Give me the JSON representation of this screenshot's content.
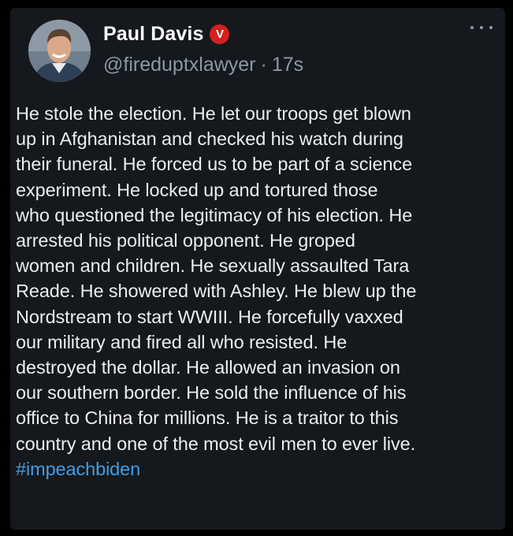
{
  "author": {
    "name": "Paul Davis",
    "badge": "V",
    "handle": "@fireduptxlawyer",
    "separator": "·",
    "timestamp": "17s"
  },
  "post": {
    "lines": [
      "He stole the election. He let our troops get blown",
      "up in Afghanistan and checked his watch during",
      "their funeral. He forced us to be part of a science",
      "experiment. He locked up and tortured those",
      "who questioned the legitimacy of his election. He",
      "arrested his political opponent. He groped",
      "women and children. He sexually assaulted Tara",
      "Reade. He showered with Ashley. He blew up the",
      "Nordstream to start WWIII. He forcefully vaxxed",
      "our military and fired all who resisted. He",
      "destroyed the dollar. He allowed an invasion on",
      "our southern border. He sold the influence of his",
      "office to China for millions. He is a traitor to this",
      "country and one of the most evil men to ever live."
    ],
    "hashtag": "#impeachbiden"
  },
  "icons": {
    "more": "more-horizontal-icon",
    "badge": "verified-badge-icon"
  },
  "colors": {
    "background": "#15181c",
    "text": "#ecedee",
    "secondary_text": "#8b98a5",
    "link": "#3f9de8",
    "badge": "#d61f1f"
  }
}
